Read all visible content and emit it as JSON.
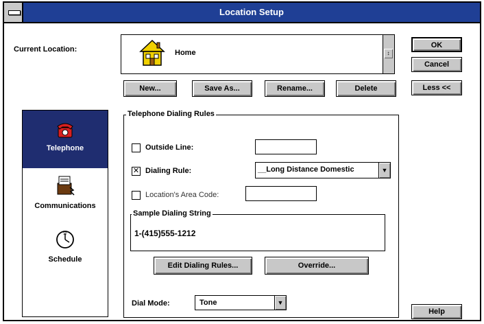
{
  "window": {
    "title": "Location Setup"
  },
  "current_location": {
    "label": "Current Location:",
    "value": "Home",
    "icon": "house-icon"
  },
  "right_buttons": {
    "ok": "OK",
    "cancel": "Cancel",
    "less": "Less <<",
    "help": "Help"
  },
  "location_buttons": {
    "new": "New...",
    "save_as": "Save As...",
    "rename": "Rename...",
    "delete": "Delete"
  },
  "sidebar": {
    "items": [
      {
        "label": "Telephone",
        "icon": "telephone-icon",
        "selected": true
      },
      {
        "label": "Communications",
        "icon": "communications-icon",
        "selected": false
      },
      {
        "label": "Schedule",
        "icon": "clock-icon",
        "selected": false
      }
    ]
  },
  "dialing_rules": {
    "group_title": "Telephone Dialing Rules",
    "outside_line": {
      "label": "Outside Line:",
      "checked": false,
      "value": ""
    },
    "dialing_rule": {
      "label": "Dialing Rule:",
      "checked": true,
      "value": "__Long Distance Domestic"
    },
    "area_code": {
      "label": "Location's Area Code:",
      "checked": false,
      "value": ""
    },
    "sample": {
      "title": "Sample Dialing String",
      "value": "1-(415)555-1212"
    },
    "edit_button": "Edit Dialing Rules...",
    "override_button": "Override...",
    "dial_mode": {
      "label": "Dial Mode:",
      "value": "Tone"
    }
  },
  "colors": {
    "titlebar": "#1f3f95",
    "selected_sidebar": "#1f2d70",
    "button_face": "#c8c8c8"
  }
}
